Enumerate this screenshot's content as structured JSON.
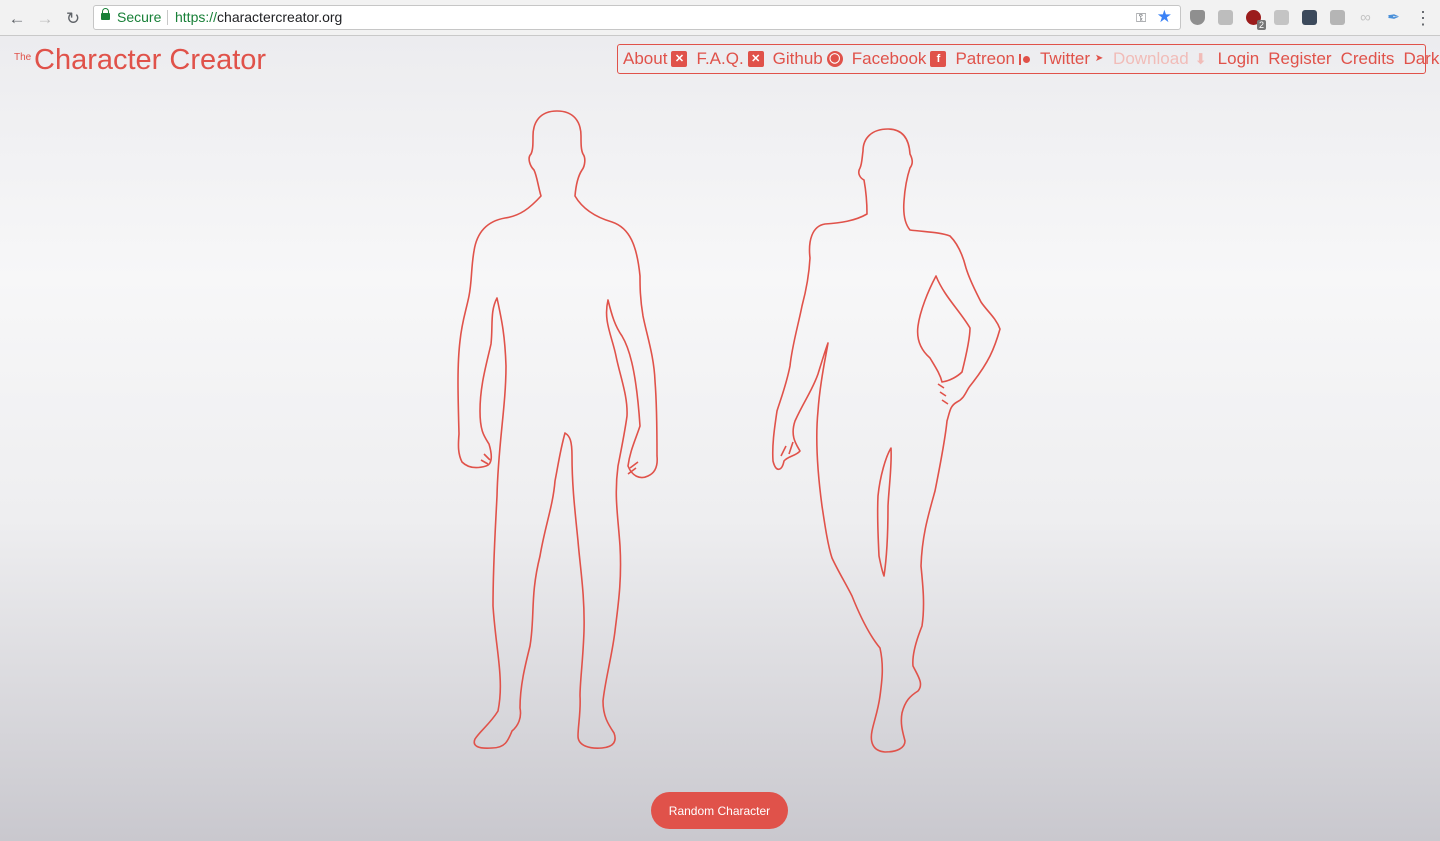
{
  "browser": {
    "secure_label": "Secure",
    "url_scheme": "https://",
    "url_host": "charactercreator.org",
    "extensions": [
      {
        "icon": "shield-icon"
      },
      {
        "icon": "search-ext-icon"
      },
      {
        "icon": "ublock-icon",
        "badge": "2"
      },
      {
        "icon": "font-ext-icon"
      },
      {
        "icon": "lock-ext-icon"
      },
      {
        "icon": "grid-ext-icon"
      },
      {
        "icon": "infinity-icon"
      },
      {
        "icon": "feather-icon"
      }
    ]
  },
  "brand": {
    "prefix": "The",
    "name": "Character Creator"
  },
  "menu": {
    "items": [
      {
        "label": "About",
        "icon": "close-box-icon"
      },
      {
        "label": "F.A.Q.",
        "icon": "close-box-icon"
      },
      {
        "label": "Github",
        "icon": "github-icon"
      },
      {
        "label": "Facebook",
        "icon": "facebook-icon"
      },
      {
        "label": "Patreon",
        "icon": "patreon-icon"
      },
      {
        "label": "Twitter",
        "icon": "twitter-icon"
      },
      {
        "label": "Download",
        "icon": "download-arrow-icon",
        "disabled": true
      },
      {
        "label": "Login"
      },
      {
        "label": "Register"
      },
      {
        "label": "Credits"
      },
      {
        "label": "Dark"
      }
    ]
  },
  "figures": {
    "options": [
      "male-silhouette",
      "female-silhouette"
    ]
  },
  "actions": {
    "random_label": "Random Character"
  },
  "colors": {
    "accent": "#e0524a",
    "accent_disabled": "#f1bcb8",
    "secure_green": "#188038"
  }
}
